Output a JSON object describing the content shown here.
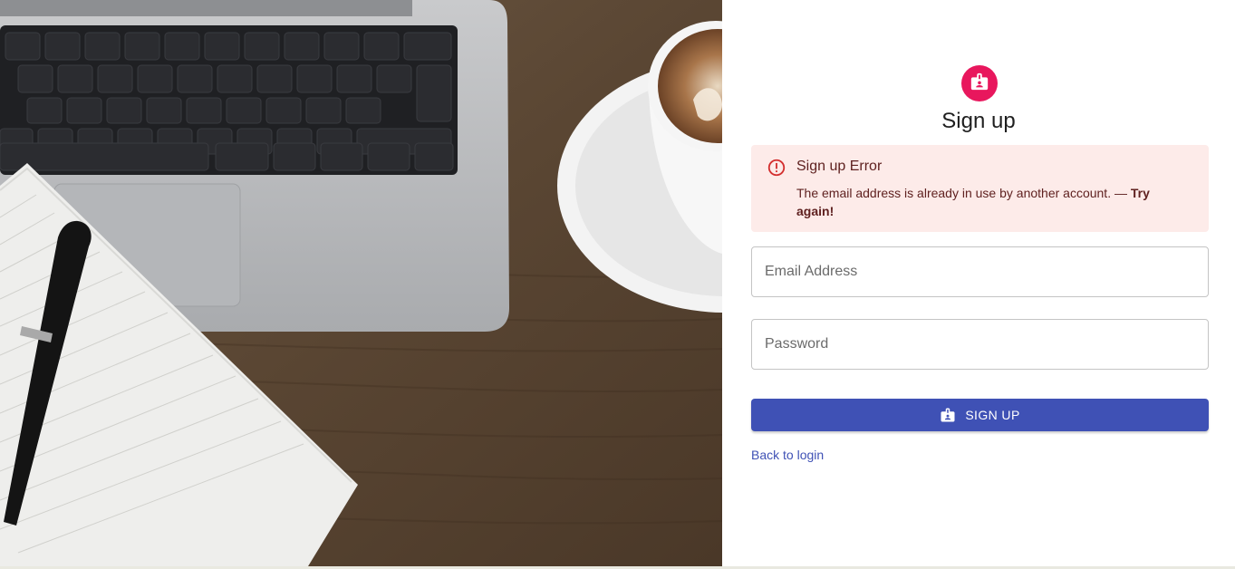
{
  "signup": {
    "title": "Sign up",
    "error": {
      "title": "Sign up Error",
      "message": "The email address is already in use by another account. — ",
      "emphasis": "Try again!"
    },
    "email": {
      "placeholder": "Email Address",
      "value": ""
    },
    "password": {
      "placeholder": "Password",
      "value": ""
    },
    "submit_label": "SIGN UP",
    "back_link": "Back to login"
  },
  "colors": {
    "accent": "#3f51b5",
    "avatar": "#e8175d",
    "error_bg": "#fdebe9",
    "error_text": "#5f2120",
    "error_icon": "#d32f2f"
  },
  "icons": {
    "avatar": "contact-badge-icon",
    "alert": "error-outline-icon",
    "button": "contact-badge-icon"
  },
  "hero_image": {
    "subject": "laptop, notebook with pen, and cup of coffee on a wooden desk"
  }
}
